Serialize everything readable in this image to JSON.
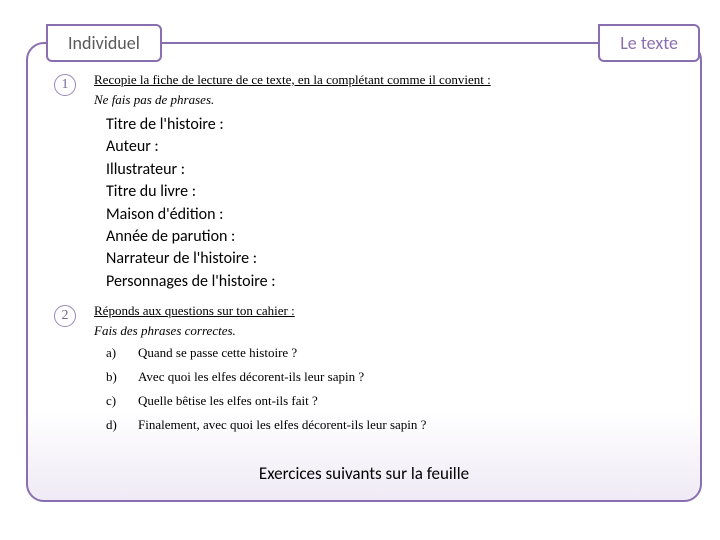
{
  "tabs": {
    "left": "Individuel",
    "right": "Le texte"
  },
  "section1": {
    "num": "1",
    "instruction": "Recopie la fiche de lecture de ce texte, en la complétant comme il convient :",
    "hint": "Ne fais pas de phrases.",
    "fields": [
      "Titre de l'histoire :",
      "Auteur :",
      "Illustrateur :",
      "Titre du livre :",
      "Maison d'édition :",
      "Année de parution :",
      "Narrateur de l'histoire :",
      "Personnages de l'histoire :"
    ]
  },
  "section2": {
    "num": "2",
    "instruction": "Réponds aux questions sur ton cahier :",
    "hint": "Fais des phrases correctes.",
    "questions": [
      {
        "label": "a)",
        "text": "Quand se passe cette histoire ?"
      },
      {
        "label": "b)",
        "text": "Avec quoi les elfes décorent-ils leur sapin ?"
      },
      {
        "label": "c)",
        "text": "Quelle bêtise les elfes ont-ils fait ?"
      },
      {
        "label": "d)",
        "text": "Finalement, avec quoi les elfes décorent-ils leur sapin ?"
      }
    ]
  },
  "footer": "Exercices suivants sur la feuille"
}
